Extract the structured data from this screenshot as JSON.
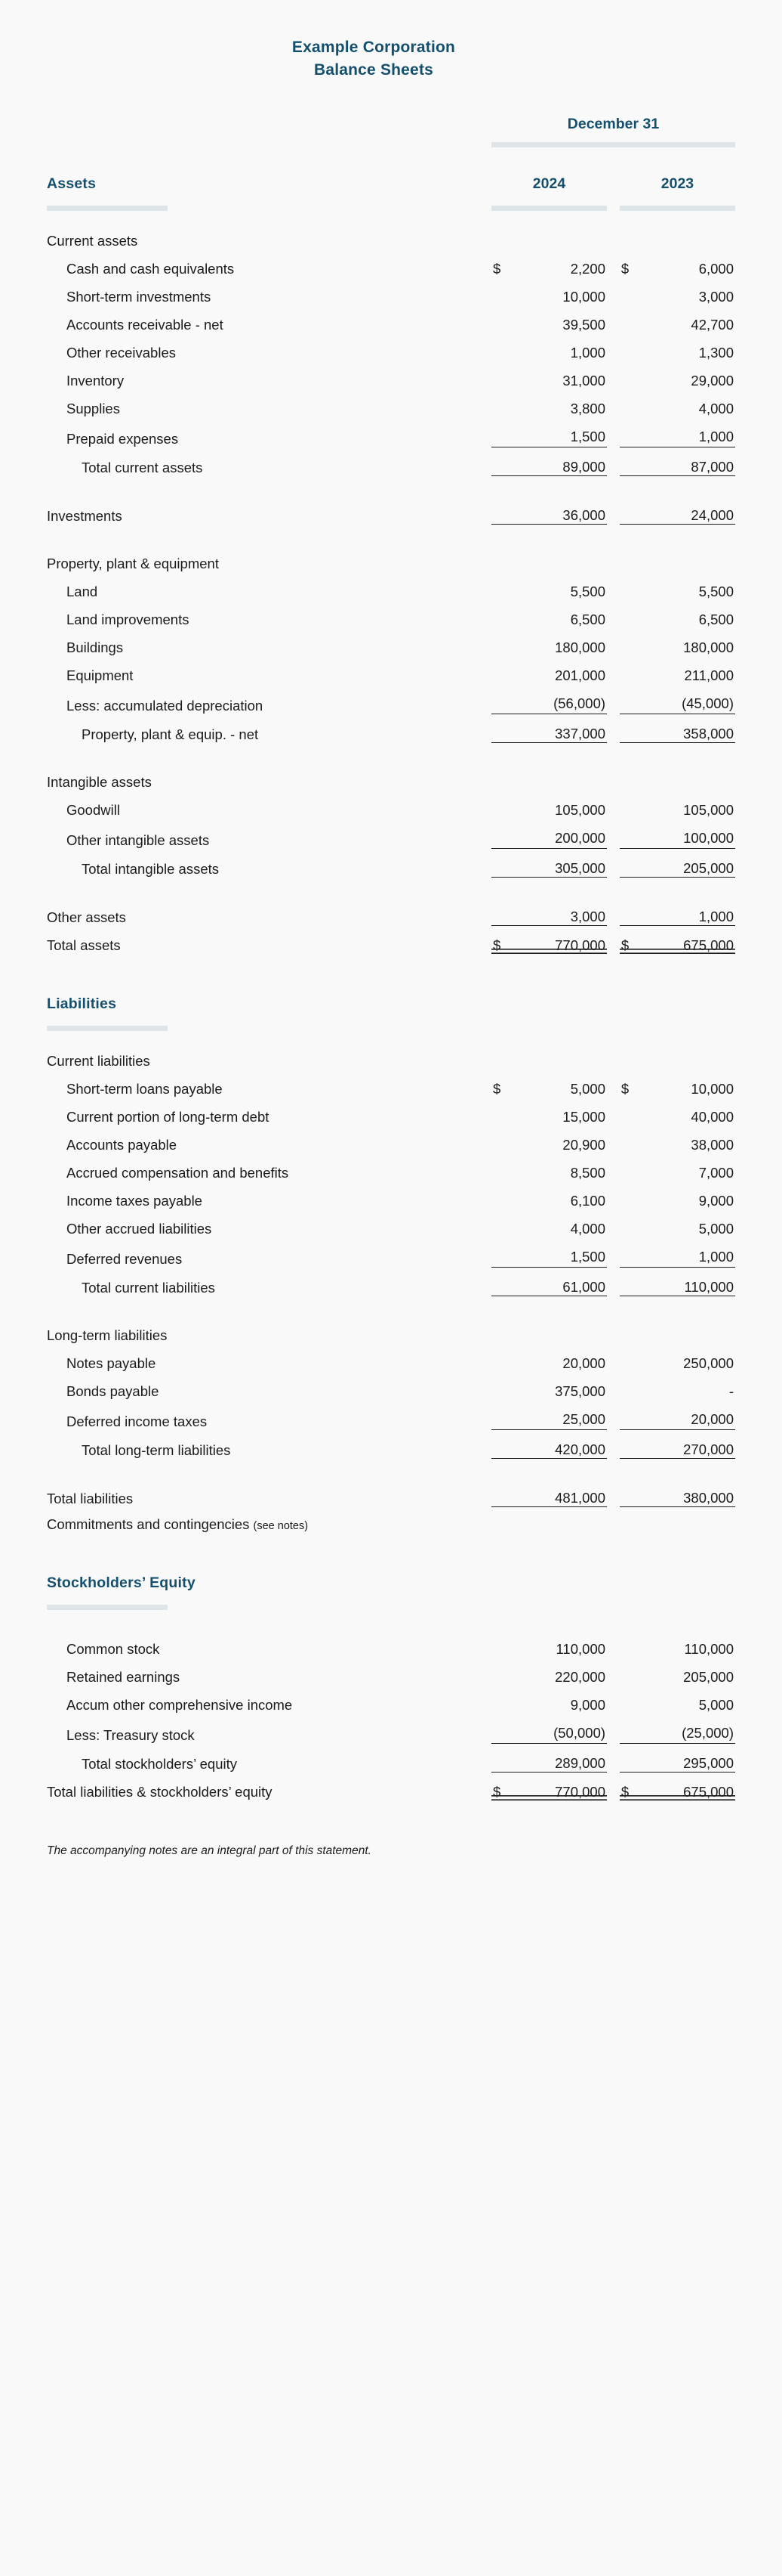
{
  "document": {
    "company": "Example Corporation",
    "statement": "Balance Sheets",
    "period_header": "December 31",
    "years": [
      "2024",
      "2023"
    ],
    "footnote": "The accompanying notes are an integral part of this statement.",
    "accent_color": "#14506e",
    "rule_color": "#dde5e9"
  },
  "sections": {
    "assets_heading": "Assets",
    "liabilities_heading": "Liabilities",
    "equity_heading": "Stockholders’ Equity"
  },
  "assets": {
    "current_assets_heading": "Current assets",
    "cash": {
      "label": "Cash and cash equivalents",
      "cur_2024": "$",
      "y2024": "2,200",
      "cur_2023": "$",
      "y2023": "6,000"
    },
    "short_term_investments": {
      "label": "Short-term investments",
      "y2024": "10,000",
      "y2023": "3,000"
    },
    "accounts_receivable": {
      "label": "Accounts receivable - net",
      "y2024": "39,500",
      "y2023": "42,700"
    },
    "other_receivables": {
      "label": "Other receivables",
      "y2024": "1,000",
      "y2023": "1,300"
    },
    "inventory": {
      "label": "Inventory",
      "y2024": "31,000",
      "y2023": "29,000"
    },
    "supplies": {
      "label": "Supplies",
      "y2024": "3,800",
      "y2023": "4,000"
    },
    "prepaid_expenses": {
      "label": "Prepaid expenses",
      "y2024": "1,500",
      "y2023": "1,000"
    },
    "total_current_assets": {
      "label": "Total current assets",
      "y2024": "89,000",
      "y2023": "87,000"
    },
    "investments": {
      "label": "Investments",
      "y2024": "36,000",
      "y2023": "24,000"
    },
    "ppe_heading": "Property, plant & equipment",
    "land": {
      "label": "Land",
      "y2024": "5,500",
      "y2023": "5,500"
    },
    "land_improvements": {
      "label": "Land improvements",
      "y2024": "6,500",
      "y2023": "6,500"
    },
    "buildings": {
      "label": "Buildings",
      "y2024": "180,000",
      "y2023": "180,000"
    },
    "equipment": {
      "label": "Equipment",
      "y2024": "201,000",
      "y2023": "211,000"
    },
    "accumulated_depreciation": {
      "label": "Less: accumulated depreciation",
      "y2024": "(56,000)",
      "y2023": "(45,000)"
    },
    "ppe_net": {
      "label": "Property, plant & equip. - net",
      "y2024": "337,000",
      "y2023": "358,000"
    },
    "intangibles_heading": "Intangible assets",
    "goodwill": {
      "label": "Goodwill",
      "y2024": "105,000",
      "y2023": "105,000"
    },
    "other_intangibles": {
      "label": "Other intangible assets",
      "y2024": "200,000",
      "y2023": "100,000"
    },
    "total_intangibles": {
      "label": "Total intangible assets",
      "y2024": "305,000",
      "y2023": "205,000"
    },
    "other_assets": {
      "label": "Other assets",
      "y2024": "3,000",
      "y2023": "1,000"
    },
    "total_assets": {
      "label": "Total assets",
      "cur_2024": "$",
      "y2024": "770,000",
      "cur_2023": "$",
      "y2023": "675,000"
    }
  },
  "liabilities": {
    "current_liabilities_heading": "Current liabilities",
    "short_term_loans": {
      "label": "Short-term loans payable",
      "cur_2024": "$",
      "y2024": "5,000",
      "cur_2023": "$",
      "y2023": "10,000"
    },
    "current_portion_ltd": {
      "label": "Current portion of long-term debt",
      "y2024": "15,000",
      "y2023": "40,000"
    },
    "accounts_payable": {
      "label": "Accounts payable",
      "y2024": "20,900",
      "y2023": "38,000"
    },
    "accrued_compensation": {
      "label": "Accrued compensation and benefits",
      "y2024": "8,500",
      "y2023": "7,000"
    },
    "income_taxes_payable": {
      "label": "Income taxes payable",
      "y2024": "6,100",
      "y2023": "9,000"
    },
    "other_accrued": {
      "label": "Other accrued liabilities",
      "y2024": "4,000",
      "y2023": "5,000"
    },
    "deferred_revenues": {
      "label": "Deferred revenues",
      "y2024": "1,500",
      "y2023": "1,000"
    },
    "total_current_liabilities": {
      "label": "Total current liabilities",
      "y2024": "61,000",
      "y2023": "110,000"
    },
    "long_term_heading": "Long-term liabilities",
    "notes_payable": {
      "label": "Notes payable",
      "y2024": "20,000",
      "y2023": "250,000"
    },
    "bonds_payable": {
      "label": "Bonds payable",
      "y2024": "375,000",
      "y2023": "-"
    },
    "deferred_income_taxes": {
      "label": "Deferred income taxes",
      "y2024": "25,000",
      "y2023": "20,000"
    },
    "total_long_term": {
      "label": "Total long-term liabilities",
      "y2024": "420,000",
      "y2023": "270,000"
    },
    "total_liabilities": {
      "label": "Total liabilities",
      "y2024": "481,000",
      "y2023": "380,000"
    },
    "commitments": {
      "label": "Commitments and contingencies",
      "note": "(see notes)"
    }
  },
  "equity": {
    "common_stock": {
      "label": "Common stock",
      "y2024": "110,000",
      "y2023": "110,000"
    },
    "retained_earnings": {
      "label": "Retained earnings",
      "y2024": "220,000",
      "y2023": "205,000"
    },
    "aoci": {
      "label": "Accum other comprehensive income",
      "y2024": "9,000",
      "y2023": "5,000"
    },
    "treasury_stock": {
      "label": "Less: Treasury stock",
      "y2024": "(50,000)",
      "y2023": "(25,000)"
    },
    "total_equity": {
      "label": "Total stockholders’ equity",
      "y2024": "289,000",
      "y2023": "295,000"
    },
    "total_liabilities_equity": {
      "label": "Total liabilities & stockholders’ equity",
      "cur_2024": "$",
      "y2024": "770,000",
      "cur_2023": "$",
      "y2023": "675,000"
    }
  }
}
